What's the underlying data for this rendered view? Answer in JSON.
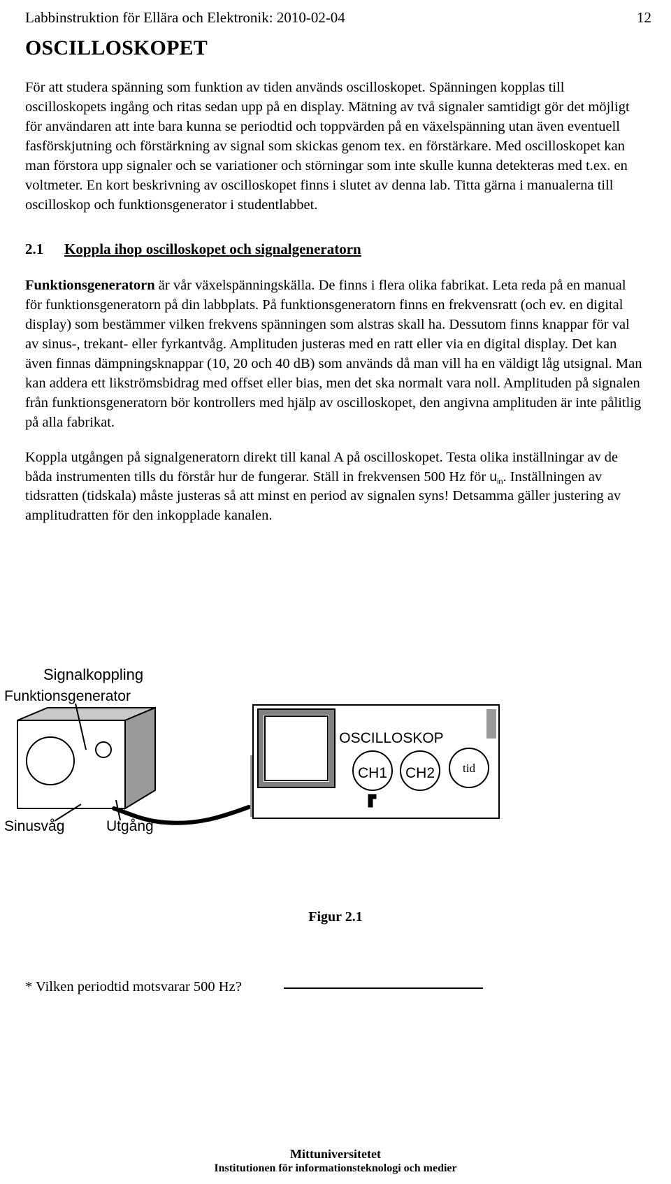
{
  "header": {
    "title": "Labbinstruktion för Ellära och Elektronik: 2010-02-04",
    "page_number": "12"
  },
  "document": {
    "title": "OSCILLOSKOPET",
    "intro_paragraph": "För att studera spänning som funktion av tiden används oscilloskopet. Spänningen kopplas till oscilloskopets ingång och ritas sedan upp på en display. Mätning av två signaler samtidigt gör det möjligt för användaren att inte bara kunna se periodtid och toppvärden på en växelspänning utan även eventuell fasförskjutning och förstärkning av signal som skickas genom tex. en förstärkare. Med oscilloskopet kan man förstora upp signaler och se variationer och störningar som inte skulle kunna detekteras med t.ex. en voltmeter. En kort beskrivning av oscilloskopet finns i slutet av denna lab. Titta gärna i manualerna till oscilloskop och funktionsgenerator i studentlabbet."
  },
  "section": {
    "number": "2.1",
    "title": "Koppla ihop oscilloskopet och signalgeneratorn",
    "paragraph1_lead": "Funktionsgeneratorn",
    "paragraph1_rest": " är vår växelspänningskälla. De finns i flera olika fabrikat. Leta reda på en manual för funktionsgeneratorn på din labbplats. På funktionsgeneratorn finns en frekvensratt (och ev. en digital display) som bestämmer vilken frekvens spänningen som alstras skall ha. Dessutom finns knappar för val av sinus-, trekant- eller fyrkantvåg. Amplituden justeras med en ratt eller via en digital display. Det kan även finnas dämpningsknappar (10, 20 och 40 dB) som används då man vill ha en väldigt låg utsignal. Man kan addera ett likströmsbidrag med offset eller bias, men det ska normalt vara noll. Amplituden på signalen från funktionsgeneratorn bör kontrollers med hjälp av oscilloskopet, den angivna amplituden är inte pålitlig på alla fabrikat.",
    "paragraph2_part1": "Koppla utgången på signalgeneratorn direkt till kanal A på oscilloskopet. Testa olika inställningar av de båda instrumenten tills du förstår hur de fungerar. Ställ in frekvensen 500 Hz för ",
    "paragraph2_symbol": "u",
    "paragraph2_symbol_sub": "in",
    "paragraph2_part2": ". Inställningen av tidsratten (tidskala) måste justeras så att minst en period av signalen syns! Detsamma gäller justering av amplitudratten för den inkopplade kanalen."
  },
  "figure": {
    "heading": "Signalkoppling",
    "generator_label": "Funktionsgenerator",
    "oscilloscope_label": "OSCILLOSKOP",
    "knob_ch1": "CH1",
    "knob_ch2": "CH2",
    "knob_time": "tid",
    "sine_label": "Sinusvåg",
    "output_label": "Utgång",
    "caption": "Figur 2.1"
  },
  "question": {
    "text": "* Vilken periodtid motsvarar 500 Hz?",
    "answer_value": ""
  },
  "footer": {
    "organisation": "Mittuniversitetet",
    "department": "Institutionen för informationsteknologi och medier"
  },
  "colors": {
    "ink": "#000000",
    "paper": "#ffffff",
    "shade_light": "#c9c9c9",
    "shade_mid": "#9a9a9a",
    "shade_dark": "#808080"
  }
}
